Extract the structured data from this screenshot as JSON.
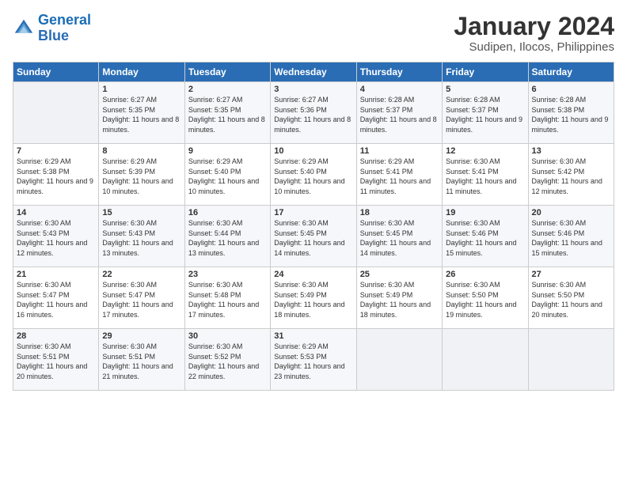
{
  "header": {
    "logo_line1": "General",
    "logo_line2": "Blue",
    "month_year": "January 2024",
    "location": "Sudipen, Ilocos, Philippines"
  },
  "days_of_week": [
    "Sunday",
    "Monday",
    "Tuesday",
    "Wednesday",
    "Thursday",
    "Friday",
    "Saturday"
  ],
  "weeks": [
    [
      {
        "day": "",
        "sunrise": "",
        "sunset": "",
        "daylight": ""
      },
      {
        "day": "1",
        "sunrise": "6:27 AM",
        "sunset": "5:35 PM",
        "daylight": "11 hours and 8 minutes."
      },
      {
        "day": "2",
        "sunrise": "6:27 AM",
        "sunset": "5:35 PM",
        "daylight": "11 hours and 8 minutes."
      },
      {
        "day": "3",
        "sunrise": "6:27 AM",
        "sunset": "5:36 PM",
        "daylight": "11 hours and 8 minutes."
      },
      {
        "day": "4",
        "sunrise": "6:28 AM",
        "sunset": "5:37 PM",
        "daylight": "11 hours and 8 minutes."
      },
      {
        "day": "5",
        "sunrise": "6:28 AM",
        "sunset": "5:37 PM",
        "daylight": "11 hours and 9 minutes."
      },
      {
        "day": "6",
        "sunrise": "6:28 AM",
        "sunset": "5:38 PM",
        "daylight": "11 hours and 9 minutes."
      }
    ],
    [
      {
        "day": "7",
        "sunrise": "6:29 AM",
        "sunset": "5:38 PM",
        "daylight": "11 hours and 9 minutes."
      },
      {
        "day": "8",
        "sunrise": "6:29 AM",
        "sunset": "5:39 PM",
        "daylight": "11 hours and 10 minutes."
      },
      {
        "day": "9",
        "sunrise": "6:29 AM",
        "sunset": "5:40 PM",
        "daylight": "11 hours and 10 minutes."
      },
      {
        "day": "10",
        "sunrise": "6:29 AM",
        "sunset": "5:40 PM",
        "daylight": "11 hours and 10 minutes."
      },
      {
        "day": "11",
        "sunrise": "6:29 AM",
        "sunset": "5:41 PM",
        "daylight": "11 hours and 11 minutes."
      },
      {
        "day": "12",
        "sunrise": "6:30 AM",
        "sunset": "5:41 PM",
        "daylight": "11 hours and 11 minutes."
      },
      {
        "day": "13",
        "sunrise": "6:30 AM",
        "sunset": "5:42 PM",
        "daylight": "11 hours and 12 minutes."
      }
    ],
    [
      {
        "day": "14",
        "sunrise": "6:30 AM",
        "sunset": "5:43 PM",
        "daylight": "11 hours and 12 minutes."
      },
      {
        "day": "15",
        "sunrise": "6:30 AM",
        "sunset": "5:43 PM",
        "daylight": "11 hours and 13 minutes."
      },
      {
        "day": "16",
        "sunrise": "6:30 AM",
        "sunset": "5:44 PM",
        "daylight": "11 hours and 13 minutes."
      },
      {
        "day": "17",
        "sunrise": "6:30 AM",
        "sunset": "5:45 PM",
        "daylight": "11 hours and 14 minutes."
      },
      {
        "day": "18",
        "sunrise": "6:30 AM",
        "sunset": "5:45 PM",
        "daylight": "11 hours and 14 minutes."
      },
      {
        "day": "19",
        "sunrise": "6:30 AM",
        "sunset": "5:46 PM",
        "daylight": "11 hours and 15 minutes."
      },
      {
        "day": "20",
        "sunrise": "6:30 AM",
        "sunset": "5:46 PM",
        "daylight": "11 hours and 15 minutes."
      }
    ],
    [
      {
        "day": "21",
        "sunrise": "6:30 AM",
        "sunset": "5:47 PM",
        "daylight": "11 hours and 16 minutes."
      },
      {
        "day": "22",
        "sunrise": "6:30 AM",
        "sunset": "5:47 PM",
        "daylight": "11 hours and 17 minutes."
      },
      {
        "day": "23",
        "sunrise": "6:30 AM",
        "sunset": "5:48 PM",
        "daylight": "11 hours and 17 minutes."
      },
      {
        "day": "24",
        "sunrise": "6:30 AM",
        "sunset": "5:49 PM",
        "daylight": "11 hours and 18 minutes."
      },
      {
        "day": "25",
        "sunrise": "6:30 AM",
        "sunset": "5:49 PM",
        "daylight": "11 hours and 18 minutes."
      },
      {
        "day": "26",
        "sunrise": "6:30 AM",
        "sunset": "5:50 PM",
        "daylight": "11 hours and 19 minutes."
      },
      {
        "day": "27",
        "sunrise": "6:30 AM",
        "sunset": "5:50 PM",
        "daylight": "11 hours and 20 minutes."
      }
    ],
    [
      {
        "day": "28",
        "sunrise": "6:30 AM",
        "sunset": "5:51 PM",
        "daylight": "11 hours and 20 minutes."
      },
      {
        "day": "29",
        "sunrise": "6:30 AM",
        "sunset": "5:51 PM",
        "daylight": "11 hours and 21 minutes."
      },
      {
        "day": "30",
        "sunrise": "6:30 AM",
        "sunset": "5:52 PM",
        "daylight": "11 hours and 22 minutes."
      },
      {
        "day": "31",
        "sunrise": "6:29 AM",
        "sunset": "5:53 PM",
        "daylight": "11 hours and 23 minutes."
      },
      {
        "day": "",
        "sunrise": "",
        "sunset": "",
        "daylight": ""
      },
      {
        "day": "",
        "sunrise": "",
        "sunset": "",
        "daylight": ""
      },
      {
        "day": "",
        "sunrise": "",
        "sunset": "",
        "daylight": ""
      }
    ]
  ]
}
